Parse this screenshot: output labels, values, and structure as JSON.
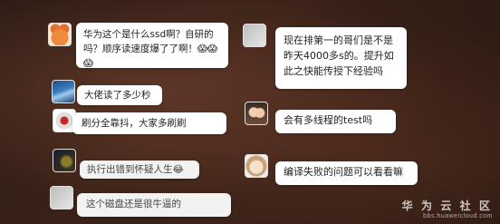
{
  "left_chat": {
    "messages": [
      {
        "avatar_icon": "fox-avatar-icon",
        "text": "华为这个是什么ssd啊？自研的吗？顺序读速度爆了了啊！😱😱😱"
      },
      {
        "avatar_icon": "wave-avatar-icon",
        "text": "大佬读了多少秒"
      },
      {
        "avatar_icon": "gear-avatar-icon",
        "text": "刷分全靠抖，大家多刷刷"
      },
      {
        "avatar_icon": "dark-avatar-icon",
        "text": "执行出错到怀疑人生😂"
      },
      {
        "avatar_icon": "gray-avatar-icon",
        "text": "这个磁盘还是很牛逼的"
      }
    ]
  },
  "right_chat": {
    "messages": [
      {
        "avatar_icon": "person-avatar-icon",
        "text": "现在排第一的哥们是不是昨天4000多s的。提升如此之快能传授下经验吗"
      },
      {
        "avatar_icon": "girl-avatar-icon",
        "text": "会有多线程的test吗"
      },
      {
        "avatar_icon": "dog-avatar-icon",
        "text": "编译失败的问题可以看看嘛"
      }
    ]
  },
  "watermark": {
    "main": "华 为 云 社 区",
    "sub": "bbs.huaweicloud.com"
  }
}
